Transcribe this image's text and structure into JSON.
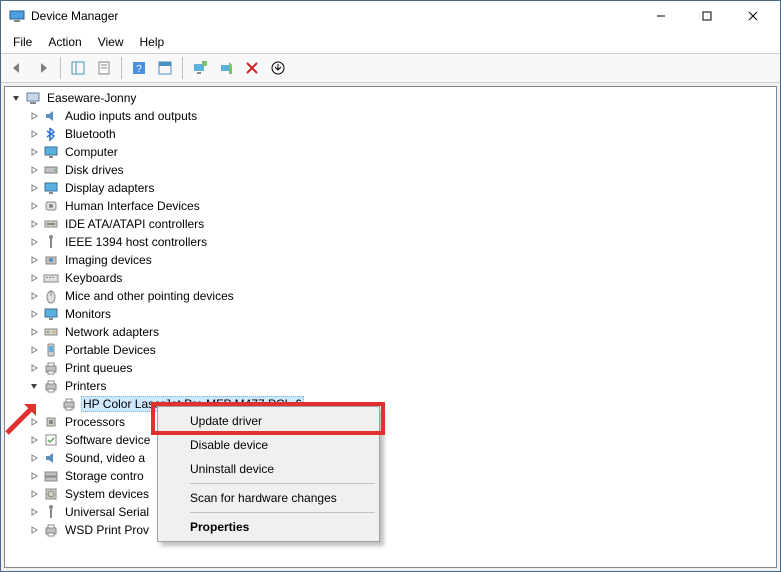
{
  "window": {
    "title": "Device Manager"
  },
  "menu": [
    "File",
    "Action",
    "View",
    "Help"
  ],
  "root": {
    "label": "Easeware-Jonny",
    "icon": "computer"
  },
  "categories": [
    {
      "label": "Audio inputs and outputs",
      "icon": "audio"
    },
    {
      "label": "Bluetooth",
      "icon": "bluetooth"
    },
    {
      "label": "Computer",
      "icon": "monitor"
    },
    {
      "label": "Disk drives",
      "icon": "disk"
    },
    {
      "label": "Display adapters",
      "icon": "monitor"
    },
    {
      "label": "Human Interface Devices",
      "icon": "hid"
    },
    {
      "label": "IDE ATA/ATAPI controllers",
      "icon": "ide"
    },
    {
      "label": "IEEE 1394 host controllers",
      "icon": "usb"
    },
    {
      "label": "Imaging devices",
      "icon": "camera"
    },
    {
      "label": "Keyboards",
      "icon": "keyboard"
    },
    {
      "label": "Mice and other pointing devices",
      "icon": "mouse"
    },
    {
      "label": "Monitors",
      "icon": "monitor"
    },
    {
      "label": "Network adapters",
      "icon": "network"
    },
    {
      "label": "Portable Devices",
      "icon": "portable"
    },
    {
      "label": "Print queues",
      "icon": "printer"
    },
    {
      "label": "Printers",
      "icon": "printer",
      "expanded": true,
      "children": [
        {
          "label": "HP Color LaserJet Pro MFP M477 PCL-6",
          "icon": "printer",
          "selected": true
        }
      ]
    },
    {
      "label": "Processors",
      "icon": "cpu"
    },
    {
      "label": "Software device",
      "icon": "software",
      "truncated": true
    },
    {
      "label": "Sound, video a",
      "icon": "audio",
      "truncated": true
    },
    {
      "label": "Storage contro",
      "icon": "storage",
      "truncated": true
    },
    {
      "label": "System devices",
      "icon": "system",
      "truncated": true
    },
    {
      "label": "Universal Serial",
      "icon": "usb",
      "truncated": true
    },
    {
      "label": "WSD Print Prov",
      "icon": "printer",
      "truncated": true
    }
  ],
  "contextMenu": [
    {
      "label": "Update driver",
      "highlighted": true
    },
    {
      "label": "Disable device"
    },
    {
      "label": "Uninstall device"
    },
    {
      "sep": true
    },
    {
      "label": "Scan for hardware changes"
    },
    {
      "sep": true
    },
    {
      "label": "Properties",
      "bold": true
    }
  ]
}
